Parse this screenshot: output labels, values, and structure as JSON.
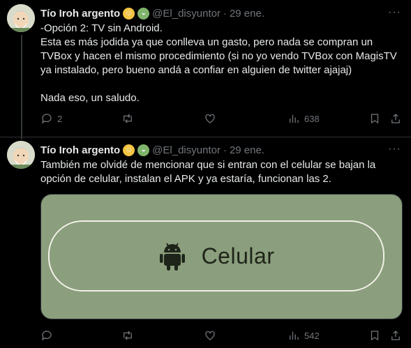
{
  "tweets": [
    {
      "author": {
        "name": "Tío Iroh argento",
        "handle": "@El_disyuntor",
        "separator": "·",
        "date": "29 ene.",
        "emoji_1": "baby-face",
        "emoji_2": "bowl-with-salad"
      },
      "text": "-Opción 2: TV sin Android.\nEsta es más jodida ya que conlleva un gasto, pero nada se compran un TVBox y hacen el mismo procedimiento (si no yo vendo TVBox con MagisTV ya instalado, pero bueno andá a confiar en alguien de twitter ajajaj)\n\nNada eso, un saludo.",
      "actions": {
        "replies": "2",
        "retweets": "",
        "likes": "",
        "views": "638"
      }
    },
    {
      "author": {
        "name": "Tío Iroh argento",
        "handle": "@El_disyuntor",
        "separator": "·",
        "date": "29 ene.",
        "emoji_1": "baby-face",
        "emoji_2": "bowl-with-salad"
      },
      "text": "También me olvidé de mencionar que si entran con el celular se bajan la opción de celular, instalan el APK y ya estaría, funcionan las 2.",
      "media": {
        "button_label": "Celular",
        "icon": "android-icon",
        "background": "#8b9e7d"
      },
      "actions": {
        "replies": "",
        "retweets": "",
        "likes": "",
        "views": "542"
      }
    }
  ],
  "colors": {
    "background": "#000000",
    "text": "#e7e9ea",
    "muted": "#71767b",
    "divider": "#2f3336"
  }
}
